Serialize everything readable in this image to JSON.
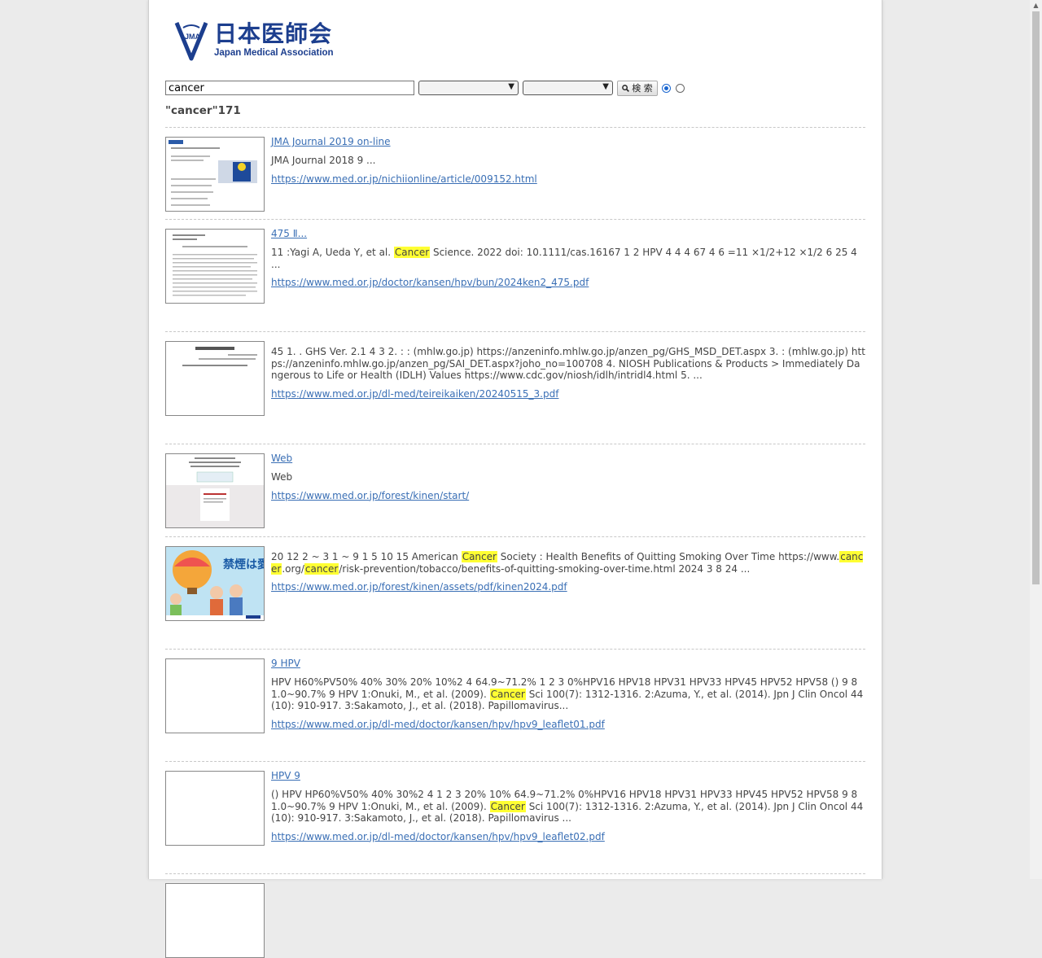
{
  "header": {
    "logo_jp": "日本医師会",
    "logo_en": "Japan Medical Association",
    "logo_mark": "JMA"
  },
  "search": {
    "query": "cancer",
    "select1": "",
    "select2": "",
    "button_label": "検 索",
    "radio1": "",
    "radio2": ""
  },
  "count_text": "\"cancer\"",
  "count_number": "171",
  "results": [
    {
      "title": "JMA Journal 2019",
      "title2": "on-line",
      "snippet": "JMA Journal 2018 9 ...",
      "url": "https://www.med.or.jp/nichiionline/article/009152.html"
    },
    {
      "title": "475 Ⅱ...",
      "snippet_pre": "11 :Yagi A, Ueda Y, et al. ",
      "hl1": "Cancer",
      "snippet_post": " Science. 2022 doi: 10.1111/cas.16167 1 2 HPV 4 4 4 67 4 6 =11 ×1/2+12 ×1/2 6 25 4 ...",
      "url": "https://www.med.or.jp/doctor/kansen/hpv/bun/2024ken2_475.pdf"
    },
    {
      "title": "",
      "snippet": "45 1. . GHS Ver. 2.1 4 3 2. : : (mhlw.go.jp) https://anzeninfo.mhlw.go.jp/anzen_pg/GHS_MSD_DET.aspx 3. : (mhlw.go.jp) https://anzeninfo.mhlw.go.jp/anzen_pg/SAI_DET.aspx?joho_no=100708 4. NIOSH Publications & Products > Immediately Dangerous to Life or Health (IDLH) Values https://www.cdc.gov/niosh/idlh/intridl4.html 5. ...",
      "url": "https://www.med.or.jp/dl-med/teireikaiken/20240515_3.pdf"
    },
    {
      "title": "Web",
      "snippet": "Web",
      "url": "https://www.med.or.jp/forest/kinen/start/"
    },
    {
      "title": "",
      "snippet_pre": "20 12 2 ~ 3 1 ~ 9 1 5 10 15 American ",
      "hl1": "Cancer",
      "snippet_mid": " Society : Health Benefits of Quitting Smoking Over Time https://www.",
      "hl2": "cancer",
      "snippet_mid2": ".org/",
      "hl3": "cancer",
      "snippet_post": "/risk-prevention/tobacco/benefits-of-quitting-smoking-over-time.html 2024 3 8 24 ...",
      "url": "https://www.med.or.jp/forest/kinen/assets/pdf/kinen2024.pdf",
      "thumb_text": "禁煙は愛"
    },
    {
      "title": "9 HPV",
      "snippet_pre": "HPV H60%PV50% 40% 30% 20% 10%2 4 64.9~71.2% 1 2 3 0%HPV16 HPV18 HPV31 HPV33 HPV45 HPV52 HPV58 () 9 81.0~90.7% 9 HPV 1:Onuki, M., et al. (2009). ",
      "hl1": "Cancer",
      "snippet_post": " Sci 100(7): 1312-1316. 2:Azuma, Y., et al. (2014). Jpn J Clin Oncol 44(10): 910-917. 3:Sakamoto, J., et al. (2018). Papillomavirus...",
      "url": "https://www.med.or.jp/dl-med/doctor/kansen/hpv/hpv9_leaflet01.pdf"
    },
    {
      "title": "HPV 9",
      "snippet_pre": "() HPV HP60%V50% 40% 30%2 4 1 2 3 20% 10% 64.9~71.2% 0%HPV16 HPV18 HPV31 HPV33 HPV45 HPV52 HPV58 9 81.0~90.7% 9 HPV 1:Onuki, M., et al. (2009). ",
      "hl1": "Cancer",
      "snippet_post": " Sci 100(7): 1312-1316. 2:Azuma, Y., et al. (2014). Jpn J Clin Oncol 44 (10): 910-917. 3:Sakamoto, J., et al. (2018). Papillomavirus ...",
      "url": "https://www.med.or.jp/dl-med/doctor/kansen/hpv/hpv9_leaflet02.pdf"
    }
  ],
  "colors": {
    "link": "#3a6fb5",
    "highlight": "#ffff33",
    "brand": "#1c3e8e"
  }
}
